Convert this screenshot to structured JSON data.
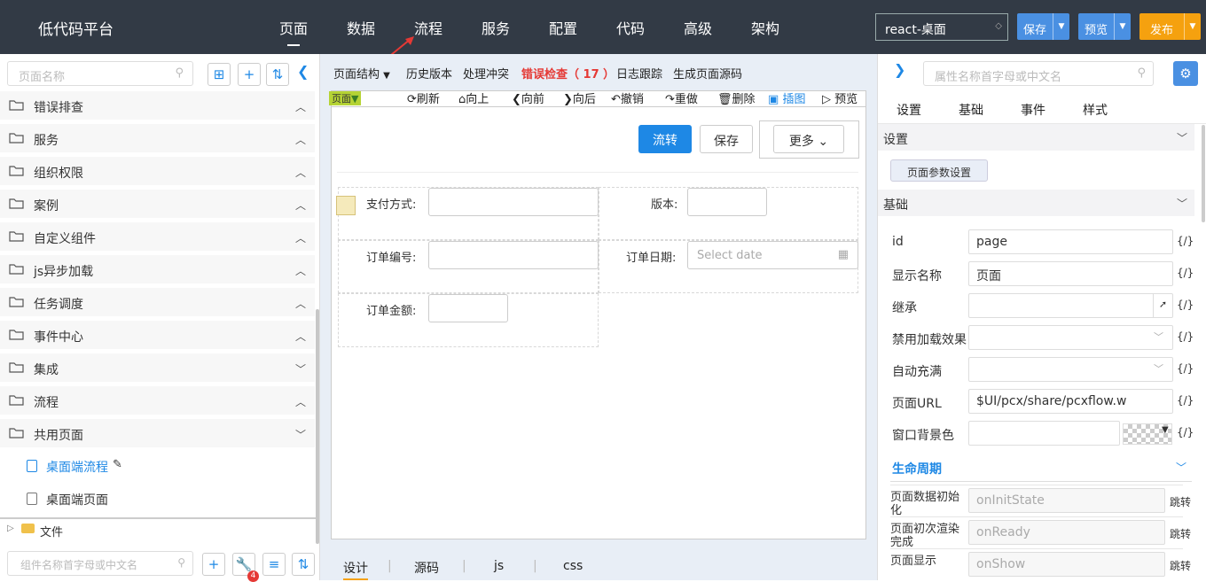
{
  "topbar": {
    "brand": "低代码平台",
    "nav": [
      "页面",
      "数据",
      "流程",
      "服务",
      "配置",
      "代码",
      "高级",
      "架构"
    ],
    "active": "页面",
    "env": "react-桌面",
    "save": "保存",
    "preview": "预览",
    "publish": "发布"
  },
  "left": {
    "search_placeholder": "页面名称",
    "tree": [
      {
        "label": "错误排查",
        "open": true
      },
      {
        "label": "服务",
        "open": true
      },
      {
        "label": "组织权限",
        "open": true
      },
      {
        "label": "案例",
        "open": true
      },
      {
        "label": "自定义组件",
        "open": true
      },
      {
        "label": "js异步加载",
        "open": true
      },
      {
        "label": "任务调度",
        "open": true
      },
      {
        "label": "事件中心",
        "open": true
      },
      {
        "label": "集成",
        "open": false
      },
      {
        "label": "流程",
        "open": true
      },
      {
        "label": "共用页面",
        "open": false
      }
    ],
    "leaves": [
      "桌面端流程",
      "桌面端页面"
    ],
    "files": "文件",
    "comp_placeholder": "组件名称首字母或中文名",
    "badge": "4"
  },
  "center": {
    "toolbar": {
      "structure": "页面结构",
      "history": "历史版本",
      "conflict": "处理冲突",
      "errors": "错误检查（ 17 ）",
      "log": "日志跟踪",
      "gen": "生成页面源码"
    },
    "toolbar2": {
      "page": "页面",
      "refresh": "刷新",
      "up": "向上",
      "prev": "向前",
      "next": "向后",
      "undo": "撤销",
      "redo": "重做",
      "del": "删除",
      "illus": "插图",
      "preview": "预览"
    },
    "form": {
      "flow": "流转",
      "save": "保存",
      "more": "更多",
      "pay": "支付方式:",
      "version": "版本:",
      "order_no": "订单编号:",
      "order_date": "订单日期:",
      "date_ph": "Select date",
      "amount": "订单金额:"
    },
    "tabs": [
      "设计",
      "源码",
      "js",
      "css"
    ]
  },
  "right": {
    "search_placeholder": "属性名称首字母或中文名",
    "tabs": [
      "设置",
      "基础",
      "事件",
      "样式"
    ],
    "sec_settings": "设置",
    "page_param_btn": "页面参数设置",
    "sec_basic": "基础",
    "props": [
      {
        "label": "id",
        "value": "page"
      },
      {
        "label": "显示名称",
        "value": "页面"
      },
      {
        "label": "继承",
        "value": ""
      },
      {
        "label": "禁用加载效果",
        "value": ""
      },
      {
        "label": "自动充满",
        "value": ""
      },
      {
        "label": "页面URL",
        "value": "$UI/pcx/share/pcxflow.w"
      },
      {
        "label": "窗口背景色",
        "value": ""
      }
    ],
    "fx": "{/}",
    "sec_life": "生命周期",
    "life": [
      {
        "label": "页面数据初始化",
        "value": "onInitState"
      },
      {
        "label": "页面初次渲染完成",
        "value": "onReady"
      },
      {
        "label": "页面显示",
        "value": "onShow"
      }
    ],
    "jump": "跳转"
  }
}
